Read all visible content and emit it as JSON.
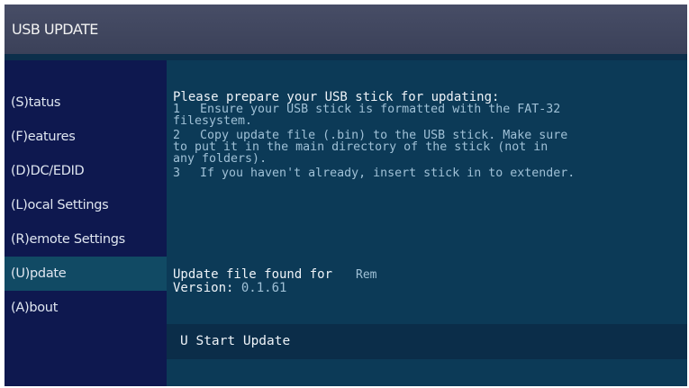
{
  "window": {
    "title": "USB UPDATE"
  },
  "sidebar": {
    "items": [
      {
        "label": "(S)tatus"
      },
      {
        "label": "(F)eatures"
      },
      {
        "label": "(D)DC/EDID"
      },
      {
        "label": "(L)ocal  Settings"
      },
      {
        "label": "(R)emote Settings"
      },
      {
        "label": "(U)pdate",
        "active": true
      },
      {
        "label": "(A)bout"
      }
    ]
  },
  "content": {
    "heading": "Please prepare your USB stick for updating:",
    "steps": [
      {
        "num": "1",
        "lines": [
          "Ensure your USB stick is formatted with the FAT-32",
          "filesystem."
        ]
      },
      {
        "num": "2",
        "lines": [
          "Copy update file (.bin) to the USB stick. Make sure",
          "to put it in the main directory of the stick (not in",
          "any folders)."
        ]
      },
      {
        "num": "3",
        "lines": [
          "If you haven't already, insert stick in to extender."
        ]
      }
    ],
    "found_label": "Update file found for",
    "found_value": "Rem",
    "version_label": "Version:",
    "version_value": "0.1.61",
    "start_button": "U Start Update"
  },
  "colors": {
    "titlebar": "#474d66",
    "sidebar": "#0e184f",
    "content": "#0c3a57",
    "active_item": "#114a64",
    "button": "#0b2d49",
    "text": "#eef3f8",
    "dim_text": "#9fc0d6"
  }
}
